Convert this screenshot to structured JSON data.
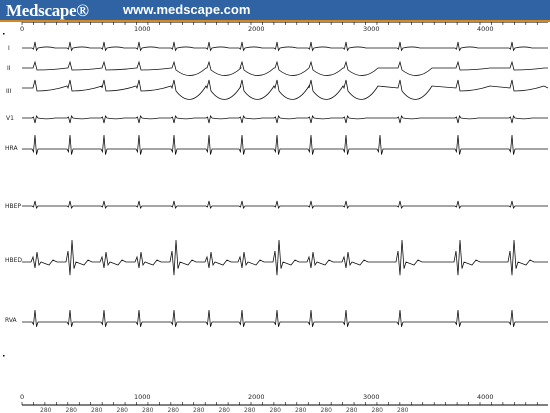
{
  "banner": {
    "brand": "Medscape®",
    "site": "www.medscape.com",
    "colors": {
      "background": "#2f63a3",
      "accent": "#d68a1d",
      "text": "#ffffff"
    }
  },
  "tracing": {
    "top_axis_labels": [
      "0",
      "1000",
      "2000",
      "3000",
      "4000"
    ],
    "bottom_axis_labels": [
      "0",
      "1000",
      "2000",
      "3000",
      "4000"
    ],
    "leads": [
      {
        "label": "I"
      },
      {
        "label": "II"
      },
      {
        "label": "III"
      },
      {
        "label": "V1"
      },
      {
        "label": "HRA"
      },
      {
        "label": "HBEP"
      },
      {
        "label": "HBED"
      },
      {
        "label": "RVA"
      }
    ],
    "interval_labels": [
      "280",
      "280",
      "280",
      "280",
      "280",
      "280",
      "280",
      "280",
      "280",
      "280",
      "280",
      "280",
      "280",
      "280",
      "280"
    ]
  }
}
